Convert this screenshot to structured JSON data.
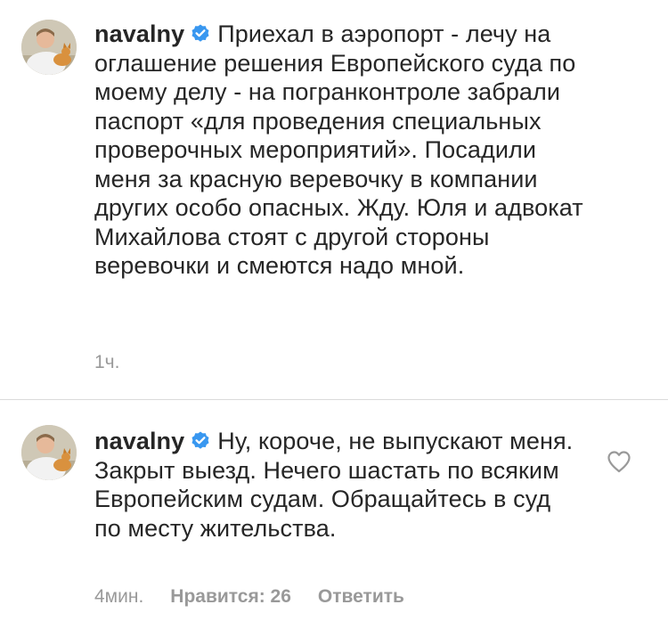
{
  "comments": [
    {
      "username": "navalny",
      "verified_icon": "verified-badge-icon",
      "text": "Приехал в аэропорт - лечу на оглашение решения Европейского суда по моему делу - на погранконтроле забрали паспорт «для проведения специальных проверочных мероприятий». Посадили меня за красную веревочку в компании других особо опасных. Жду. Юля и адвокат Михайлова стоят с другой стороны веревочки и смеются надо мной.",
      "time": "1ч."
    },
    {
      "username": "navalny",
      "verified_icon": "verified-badge-icon",
      "text": "Ну, короче, не выпускают меня. Закрыт выезд. Нечего шастать по всяким Европейским судам. Обращайтесь в суд по месту жительства.",
      "time": "4мин.",
      "likes": "Нравится: 26",
      "reply": "Ответить",
      "like_icon": "heart-outline-icon"
    }
  ],
  "colors": {
    "text": "#262626",
    "meta": "#999999",
    "verified": "#3897f0",
    "divider": "#dbdbdb"
  }
}
